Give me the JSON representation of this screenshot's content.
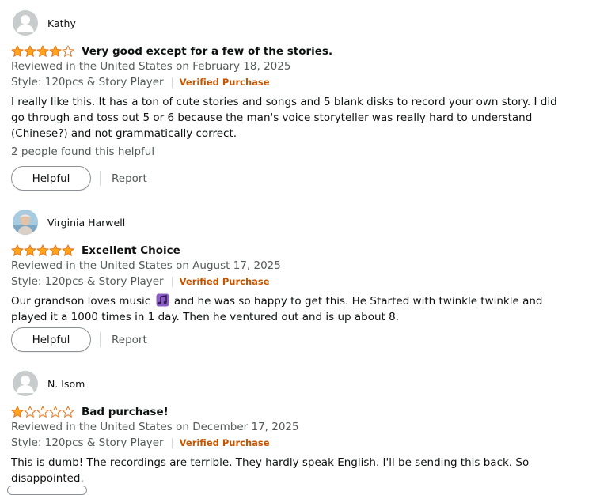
{
  "colors": {
    "star_filled": "#ffa41c",
    "star_border": "#de7921",
    "verified": "#c45500",
    "secondary_text": "#565959",
    "primary_text": "#0f1111"
  },
  "reviews": [
    {
      "reviewer": "Kathy",
      "avatar": "default-avatar-icon",
      "rating": 4,
      "title": "Very good except for a few of the stories.",
      "date": "Reviewed in the United States on February 18, 2025",
      "style": "Style: 120pcs & Story Player",
      "verified": "Verified Purchase",
      "body": "I really like this. It has a ton of cute stories and songs and 5 blank disks to record your own story. I did go through and toss out 5 or 6 because the man's voice storyteller was really hard to understand (Chinese?) and not grammatically correct.",
      "helpful_count": "2 people found this helpful",
      "helpful_label": "Helpful",
      "report_label": "Report"
    },
    {
      "reviewer": "Virginia Harwell",
      "avatar": "photo-avatar-icon",
      "rating": 5,
      "title": "Excellent Choice",
      "date": "Reviewed in the United States on August 17, 2025",
      "style": "Style: 120pcs & Story Player",
      "verified": "Verified Purchase",
      "body_before": "Our grandson loves music ",
      "body_emoji": "music-notes-icon",
      "body_after": " and he was so happy to get this. He Started with twinkle twinkle and played it a 1000 times in 1 day. Then he ventured out and is up about 8.",
      "helpful_label": "Helpful",
      "report_label": "Report"
    },
    {
      "reviewer": "N. Isom",
      "avatar": "default-avatar-icon",
      "rating": 1,
      "title": "Bad purchase!",
      "date": "Reviewed in the United States on December 17, 2025",
      "style": "Style: 120pcs & Story Player",
      "verified": "Verified Purchase",
      "body": "This is dumb! The recordings are terrible. They hardly speak English. I'll be sending this back. So disappointed."
    }
  ]
}
